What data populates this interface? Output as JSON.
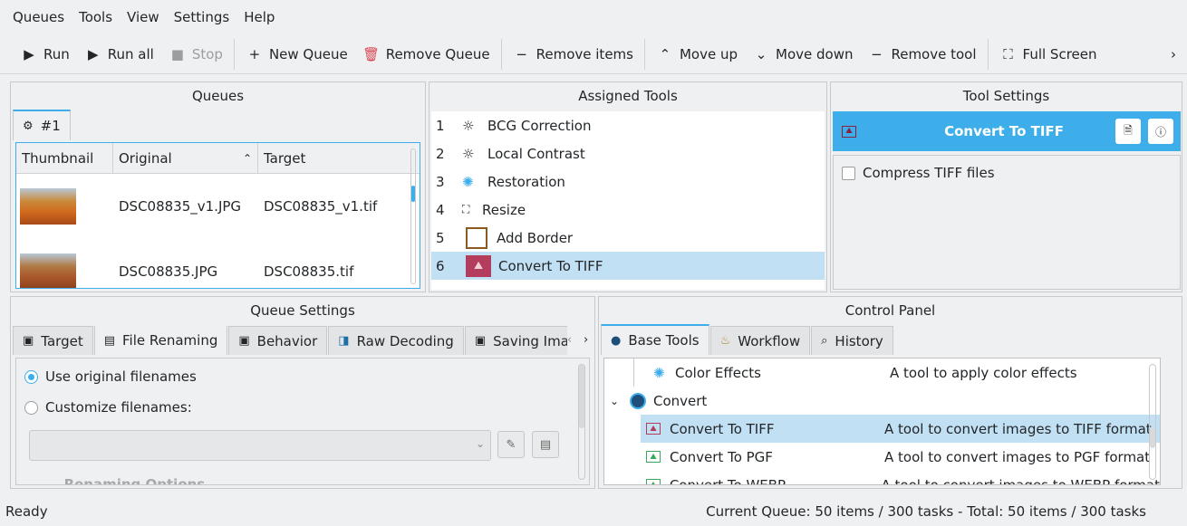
{
  "menu": [
    "Queues",
    "Tools",
    "View",
    "Settings",
    "Help"
  ],
  "toolbar": {
    "run": "Run",
    "run_all": "Run all",
    "stop": "Stop",
    "new_queue": "New Queue",
    "remove_queue": "Remove Queue",
    "remove_items": "Remove items",
    "move_up": "Move up",
    "move_down": "Move down",
    "remove_tool": "Remove tool",
    "full_screen": "Full Screen"
  },
  "queues": {
    "title": "Queues",
    "tab": "#1",
    "columns": [
      "Thumbnail",
      "Original",
      "Target"
    ],
    "rows": [
      {
        "original": "DSC08835_v1.JPG",
        "target": "DSC08835_v1.tif"
      },
      {
        "original": "DSC08835.JPG",
        "target": "DSC08835.tif"
      }
    ]
  },
  "assigned": {
    "title": "Assigned Tools",
    "items": [
      {
        "n": "1",
        "label": "BCG Correction"
      },
      {
        "n": "2",
        "label": "Local Contrast"
      },
      {
        "n": "3",
        "label": "Restoration"
      },
      {
        "n": "4",
        "label": "Resize"
      },
      {
        "n": "5",
        "label": "Add Border"
      },
      {
        "n": "6",
        "label": "Convert To TIFF"
      }
    ]
  },
  "tool_settings": {
    "title": "Tool Settings",
    "header": "Convert To TIFF",
    "compress": "Compress TIFF files"
  },
  "queue_settings": {
    "title": "Queue Settings",
    "tabs": [
      "Target",
      "File Renaming",
      "Behavior",
      "Raw Decoding",
      "Saving Imag"
    ],
    "use_original": "Use original filenames",
    "customize": "Customize filenames:",
    "renaming_options": "Renaming Options"
  },
  "control": {
    "title": "Control Panel",
    "tabs": [
      "Base Tools",
      "Workflow",
      "History"
    ],
    "rows": [
      {
        "name": "Color Effects",
        "desc": "A tool to apply color effects"
      },
      {
        "name": "Convert",
        "desc": ""
      },
      {
        "name": "Convert To TIFF",
        "desc": "A tool to convert images to TIFF format"
      },
      {
        "name": "Convert To PGF",
        "desc": "A tool to convert images to PGF format"
      },
      {
        "name": "Convert To WEBP",
        "desc": "A tool to convert images to WEBP format"
      }
    ]
  },
  "status": {
    "left": "Ready",
    "right": "Current Queue: 50 items / 300 tasks - Total: 50 items / 300 tasks"
  },
  "colors": {
    "accent": "#3daee9",
    "selection": "#c2e0f4",
    "remove": "#da4453"
  }
}
